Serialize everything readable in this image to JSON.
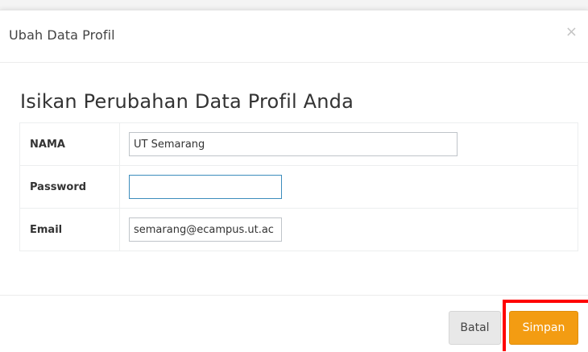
{
  "modal": {
    "title": "Ubah Data Profil",
    "close_icon": "×",
    "heading": "Isikan Perubahan Data Profil Anda"
  },
  "form": {
    "rows": [
      {
        "label": "NAMA",
        "value": "UT Semarang"
      },
      {
        "label": "Password",
        "value": ""
      },
      {
        "label": "Email",
        "value": "semarang@ecampus.ut.ac"
      }
    ]
  },
  "footer": {
    "cancel_label": "Batal",
    "save_label": "Simpan"
  },
  "colors": {
    "accent": "#f39c12",
    "focus_border": "#3c8dbc",
    "highlight": "#ff0000"
  }
}
